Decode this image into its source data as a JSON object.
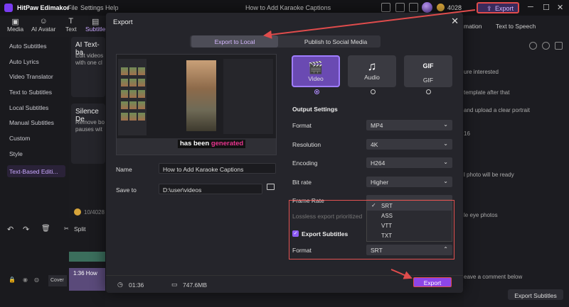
{
  "titlebar": {
    "app_name": "HitPaw Edimakor",
    "menus": [
      "File",
      "Settings",
      "Help"
    ],
    "doc_title": "How to Add Karaoke Captions",
    "credits": "4028",
    "export_label": "Export",
    "accent": "#7a3cf0",
    "highlight": "#e04c4c"
  },
  "toolbar_tabs": [
    {
      "label": "Media",
      "icon": "media-icon"
    },
    {
      "label": "AI Avatar",
      "icon": "avatar-icon"
    },
    {
      "label": "Text",
      "icon": "text-icon"
    },
    {
      "label": "Subtitle",
      "icon": "subtitle-icon"
    }
  ],
  "sidebar": {
    "items": [
      "Auto Subtitles",
      "Auto Lyrics",
      "Video Translator",
      "Text to Subtitles",
      "Local Subtitles",
      "Manual Subtitles",
      "Custom",
      "Style",
      "Text-Based Editi..."
    ],
    "credits": "10/4028"
  },
  "cards": {
    "ai_text_title": "AI Text-ba",
    "ai_text_desc1": "Edit videos",
    "ai_text_desc2": "with one cl",
    "silence_title": "Silence De",
    "silence_desc1": "Remove bo",
    "silence_desc2": "pauses wit"
  },
  "right_panel": {
    "tabs": [
      "mation",
      "Text to Speech"
    ],
    "lines": [
      "ure interested",
      "template after that",
      "and upload a clear portrait",
      "16",
      "l photo will be ready",
      "le eye photos",
      "eave a comment below"
    ],
    "export_subtitles": "Export Subtitles"
  },
  "timeline": {
    "split": "Split",
    "clip_time": "1:36 How",
    "track_label": "Cover"
  },
  "modal": {
    "title": "Export",
    "tab_local": "Export to Local",
    "tab_social": "Publish to Social Media",
    "caption_prefix": "has been",
    "caption_highlight": "generated",
    "name_label": "Name",
    "name_value": "How to Add Karaoke Captions",
    "save_label": "Save to",
    "save_value": "D:\\user\\videos",
    "types": [
      {
        "label": "Video",
        "icon": "video-icon"
      },
      {
        "label": "Audio",
        "icon": "music-icon"
      },
      {
        "label": "GIF",
        "icon": "gif-icon"
      }
    ],
    "output_settings": "Output Settings",
    "settings": [
      {
        "label": "Format",
        "value": "MP4"
      },
      {
        "label": "Resolution",
        "value": "4K"
      },
      {
        "label": "Encoding",
        "value": "H264"
      },
      {
        "label": "Bit rate",
        "value": "Higher"
      },
      {
        "label": "Frame Rate",
        "value": ""
      }
    ],
    "lossless_label": "Lossless export prioritized",
    "subtitle_options": [
      "SRT",
      "ASS",
      "VTT",
      "TXT"
    ],
    "export_subtitles_label": "Export Subtitles",
    "subtitle_format_label": "Format",
    "subtitle_format_value": "SRT",
    "duration": "01:36",
    "size": "747.6MB",
    "export_button": "Export"
  }
}
